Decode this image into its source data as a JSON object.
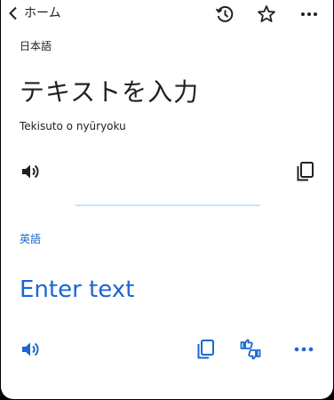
{
  "header": {
    "back_label": "ホーム",
    "icons": [
      "chevron-left-icon",
      "history-icon",
      "star-icon",
      "more-vert-icon"
    ]
  },
  "source": {
    "language": "日本語",
    "text": "テキストを入力",
    "transliteration": "Tekisuto o nyūryoku"
  },
  "target": {
    "language": "英語",
    "text": "Enter text"
  },
  "colors": {
    "accent": "#1967d2",
    "text": "#202124",
    "divider": "#c8e6f3"
  }
}
